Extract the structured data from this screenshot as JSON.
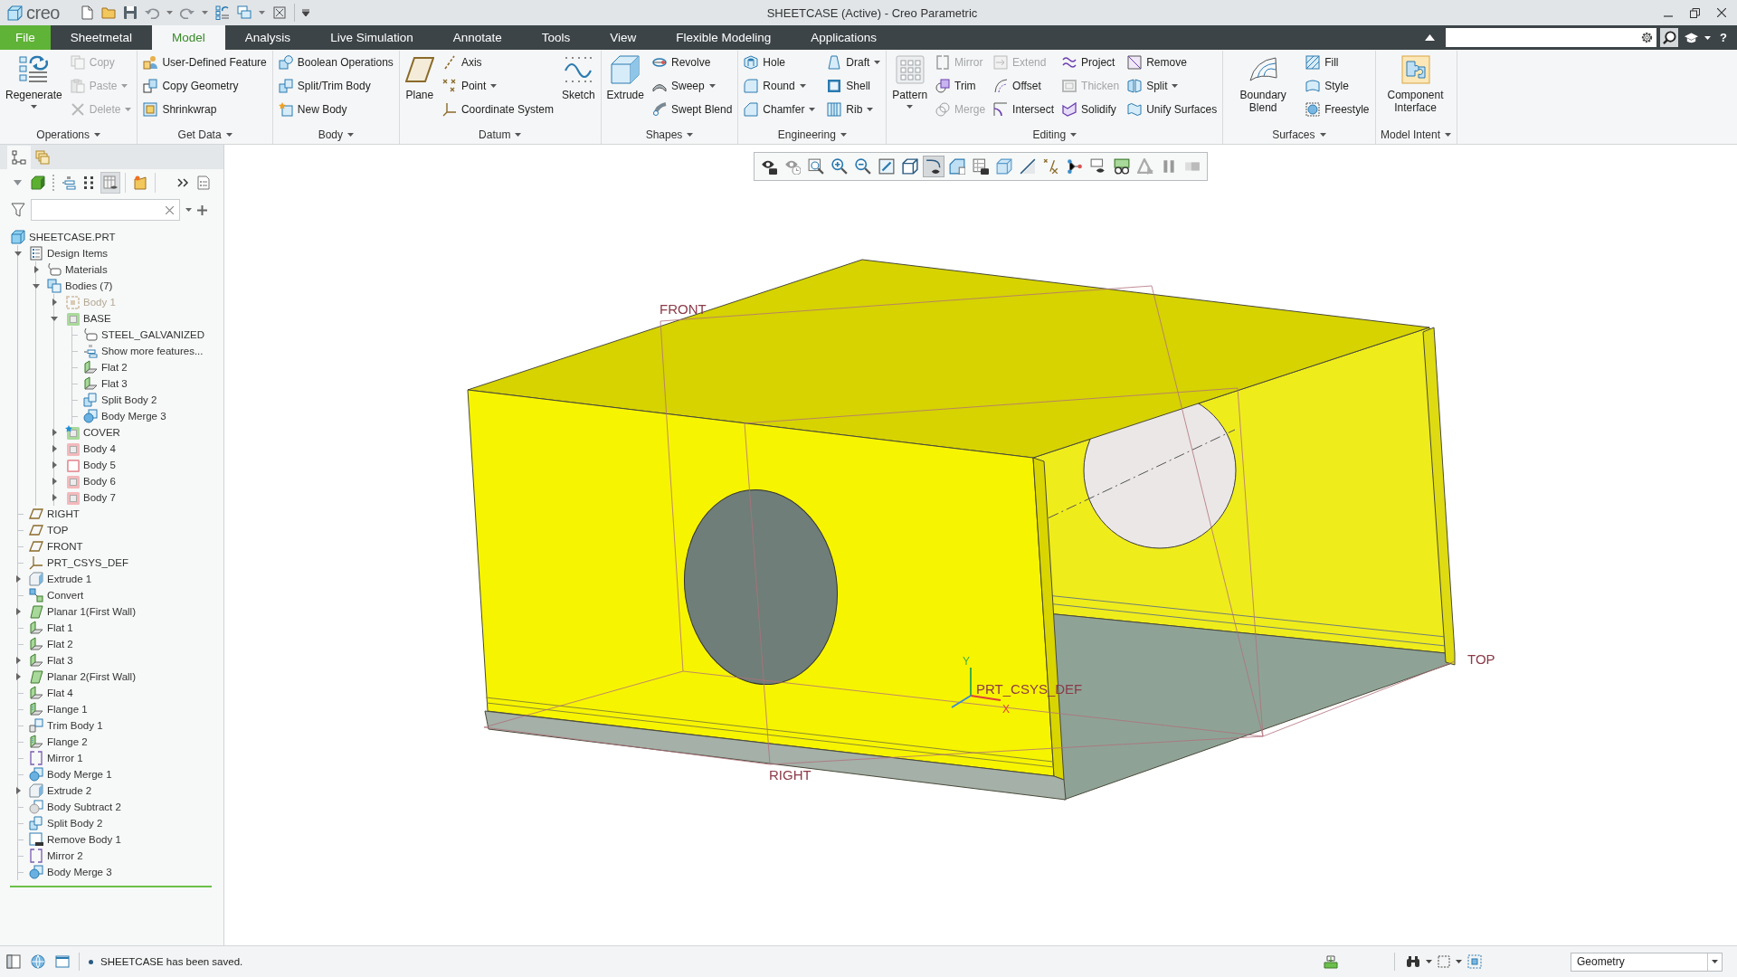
{
  "title_bar": {
    "logo": "creo",
    "title": "SHEETCASE (Active) - Creo Parametric"
  },
  "tabs": [
    {
      "label": "File",
      "kind": "menu",
      "selected": false
    },
    {
      "label": "Sheetmetal",
      "kind": "tab",
      "selected": false
    },
    {
      "label": "Model",
      "kind": "tab",
      "selected": true
    },
    {
      "label": "Analysis",
      "kind": "tab",
      "selected": false
    },
    {
      "label": "Live Simulation",
      "kind": "tab",
      "selected": false
    },
    {
      "label": "Annotate",
      "kind": "tab",
      "selected": false
    },
    {
      "label": "Tools",
      "kind": "tab",
      "selected": false
    },
    {
      "label": "View",
      "kind": "tab",
      "selected": false
    },
    {
      "label": "Flexible Modeling",
      "kind": "tab",
      "selected": false
    },
    {
      "label": "Applications",
      "kind": "tab",
      "selected": false
    }
  ],
  "help": "?",
  "ribbon": {
    "groups": [
      {
        "label": "Operations",
        "columns": [
          {
            "kind": "large",
            "items": [
              {
                "label": "Regenerate",
                "disabled": false,
                "dropdown": true
              }
            ]
          },
          {
            "kind": "stack",
            "items": [
              {
                "label": "Copy",
                "disabled": true,
                "dropdown": false
              },
              {
                "label": "Paste",
                "disabled": true,
                "dropdown": true
              },
              {
                "label": "Delete",
                "disabled": true,
                "dropdown": true
              }
            ]
          }
        ]
      },
      {
        "label": "Get Data",
        "columns": [
          {
            "kind": "stack",
            "items": [
              {
                "label": "User-Defined Feature",
                "disabled": false,
                "dropdown": false
              },
              {
                "label": "Copy Geometry",
                "disabled": false,
                "dropdown": false
              },
              {
                "label": "Shrinkwrap",
                "disabled": false,
                "dropdown": false
              }
            ]
          }
        ]
      },
      {
        "label": "Body",
        "columns": [
          {
            "kind": "stack",
            "items": [
              {
                "label": "Boolean Operations",
                "disabled": false,
                "dropdown": false
              },
              {
                "label": "Split/Trim Body",
                "disabled": false,
                "dropdown": false
              },
              {
                "label": "New Body",
                "disabled": false,
                "dropdown": false
              }
            ]
          }
        ]
      },
      {
        "label": "Datum",
        "columns": [
          {
            "kind": "large",
            "items": [
              {
                "label": "Plane",
                "disabled": false,
                "dropdown": false
              }
            ]
          },
          {
            "kind": "stack",
            "items": [
              {
                "label": "Axis",
                "disabled": false,
                "dropdown": false
              },
              {
                "label": "Point",
                "disabled": false,
                "dropdown": true
              },
              {
                "label": "Coordinate System",
                "disabled": false,
                "dropdown": false
              }
            ]
          },
          {
            "kind": "large",
            "items": [
              {
                "label": "Sketch",
                "disabled": false,
                "dropdown": false
              }
            ]
          }
        ]
      },
      {
        "label": "Shapes",
        "columns": [
          {
            "kind": "large",
            "items": [
              {
                "label": "Extrude",
                "disabled": false,
                "dropdown": false
              }
            ]
          },
          {
            "kind": "stack",
            "items": [
              {
                "label": "Revolve",
                "disabled": false,
                "dropdown": false
              },
              {
                "label": "Sweep",
                "disabled": false,
                "dropdown": true
              },
              {
                "label": "Swept Blend",
                "disabled": false,
                "dropdown": false
              }
            ]
          }
        ]
      },
      {
        "label": "Engineering",
        "columns": [
          {
            "kind": "stack",
            "items": [
              {
                "label": "Hole",
                "disabled": false,
                "dropdown": false
              },
              {
                "label": "Round",
                "disabled": false,
                "dropdown": true
              },
              {
                "label": "Chamfer",
                "disabled": false,
                "dropdown": true
              }
            ]
          },
          {
            "kind": "stack",
            "items": [
              {
                "label": "Draft",
                "disabled": false,
                "dropdown": true
              },
              {
                "label": "Shell",
                "disabled": false,
                "dropdown": false
              },
              {
                "label": "Rib",
                "disabled": false,
                "dropdown": true
              }
            ]
          }
        ]
      },
      {
        "label": "Editing",
        "columns": [
          {
            "kind": "large",
            "items": [
              {
                "label": "Pattern",
                "disabled": false,
                "dropdown": true
              }
            ]
          },
          {
            "kind": "stack",
            "items": [
              {
                "label": "Mirror",
                "disabled": true,
                "dropdown": false
              },
              {
                "label": "Trim",
                "disabled": false,
                "dropdown": false
              },
              {
                "label": "Merge",
                "disabled": true,
                "dropdown": false
              }
            ]
          },
          {
            "kind": "stack",
            "items": [
              {
                "label": "Extend",
                "disabled": true,
                "dropdown": false
              },
              {
                "label": "Offset",
                "disabled": false,
                "dropdown": false
              },
              {
                "label": "Intersect",
                "disabled": false,
                "dropdown": false
              }
            ]
          },
          {
            "kind": "stack",
            "items": [
              {
                "label": "Project",
                "disabled": false,
                "dropdown": false
              },
              {
                "label": "Thicken",
                "disabled": true,
                "dropdown": false
              },
              {
                "label": "Solidify",
                "disabled": false,
                "dropdown": false
              }
            ]
          },
          {
            "kind": "stack",
            "items": [
              {
                "label": "Remove",
                "disabled": false,
                "dropdown": false
              },
              {
                "label": "Split",
                "disabled": false,
                "dropdown": true
              },
              {
                "label": "Unify Surfaces",
                "disabled": false,
                "dropdown": false
              }
            ]
          }
        ]
      },
      {
        "label": "Surfaces",
        "columns": [
          {
            "kind": "large",
            "items": [
              {
                "label": "Boundary Blend",
                "disabled": false,
                "dropdown": false
              }
            ]
          },
          {
            "kind": "stack",
            "items": [
              {
                "label": "Fill",
                "disabled": false,
                "dropdown": false
              },
              {
                "label": "Style",
                "disabled": false,
                "dropdown": false
              },
              {
                "label": "Freestyle",
                "disabled": false,
                "dropdown": false
              }
            ]
          }
        ]
      },
      {
        "label": "Model Intent",
        "columns": [
          {
            "kind": "large",
            "items": [
              {
                "label": "Component Interface",
                "disabled": false,
                "dropdown": false
              }
            ]
          }
        ]
      }
    ]
  },
  "model_tree": {
    "tabs": [
      {
        "selected": true
      },
      {
        "selected": false
      }
    ],
    "toolbar": [
      {
        "selected": false
      },
      {
        "selected": false
      },
      {
        "selected": false
      },
      {
        "selected": false
      },
      {
        "selected": true
      },
      {
        "selected": false
      },
      {
        "selected": false
      },
      {
        "selected": false
      }
    ],
    "items": [
      {
        "label": "SHEETCASE.PRT",
        "kind": "part",
        "children": [
          {
            "label": "Design Items",
            "kind": "design_items",
            "expanded": true,
            "children": [
              {
                "label": "Materials",
                "kind": "materials",
                "expanded": false
              },
              {
                "label": "Bodies (7)",
                "kind": "bodies",
                "expanded": true,
                "children": [
                  {
                    "label": "Body 1",
                    "kind": "body",
                    "color": "#d8cbb6",
                    "hidden": true,
                    "default": false,
                    "empty": false,
                    "expanded": false
                  },
                  {
                    "label": "BASE",
                    "kind": "body",
                    "color": "#a9d99b",
                    "hidden": false,
                    "default": false,
                    "empty": false,
                    "expanded": true,
                    "children": [
                      {
                        "label": "STEEL_GALVANIZED",
                        "kind": "material"
                      },
                      {
                        "label": "Show more features...",
                        "kind": "more"
                      },
                      {
                        "label": "Flat 2",
                        "kind": "flat"
                      },
                      {
                        "label": "Flat 3",
                        "kind": "flat"
                      },
                      {
                        "label": "Split Body 2",
                        "kind": "split"
                      },
                      {
                        "label": "Body Merge 3",
                        "kind": "merge"
                      }
                    ]
                  },
                  {
                    "label": "COVER",
                    "kind": "body",
                    "color": "#a9d99b",
                    "hidden": false,
                    "default": true,
                    "empty": false,
                    "expanded": false
                  },
                  {
                    "label": "Body 4",
                    "kind": "body",
                    "color": "#f2b9bc",
                    "hidden": false,
                    "default": false,
                    "empty": false,
                    "expanded": false
                  },
                  {
                    "label": "Body 5",
                    "kind": "body",
                    "color": "#e8959b",
                    "hidden": false,
                    "default": false,
                    "empty": true,
                    "expanded": false
                  },
                  {
                    "label": "Body 6",
                    "kind": "body",
                    "color": "#f2b9bc",
                    "hidden": false,
                    "default": false,
                    "empty": false,
                    "expanded": false
                  },
                  {
                    "label": "Body 7",
                    "kind": "body",
                    "color": "#f2b9bc",
                    "hidden": false,
                    "default": false,
                    "empty": false,
                    "expanded": false
                  }
                ]
              }
            ]
          },
          {
            "label": "RIGHT",
            "kind": "plane"
          },
          {
            "label": "TOP",
            "kind": "plane"
          },
          {
            "label": "FRONT",
            "kind": "plane"
          },
          {
            "label": "PRT_CSYS_DEF",
            "kind": "csys"
          },
          {
            "label": "Extrude 1",
            "kind": "extrude",
            "expanded": false
          },
          {
            "label": "Convert",
            "kind": "convert"
          },
          {
            "label": "Planar 1(First Wall)",
            "kind": "planar",
            "expanded": false
          },
          {
            "label": "Flat 1",
            "kind": "flat"
          },
          {
            "label": "Flat 2",
            "kind": "flat"
          },
          {
            "label": "Flat 3",
            "kind": "flat",
            "expanded": false
          },
          {
            "label": "Planar 2(First Wall)",
            "kind": "planar",
            "expanded": false
          },
          {
            "label": "Flat 4",
            "kind": "flat"
          },
          {
            "label": "Flange 1",
            "kind": "flange"
          },
          {
            "label": "Trim Body 1",
            "kind": "trim"
          },
          {
            "label": "Flange 2",
            "kind": "flange"
          },
          {
            "label": "Mirror 1",
            "kind": "mirror"
          },
          {
            "label": "Body Merge 1",
            "kind": "merge"
          },
          {
            "label": "Extrude 2",
            "kind": "extrude",
            "expanded": false
          },
          {
            "label": "Body Subtract 2",
            "kind": "subtract"
          },
          {
            "label": "Split Body 2",
            "kind": "split"
          },
          {
            "label": "Remove Body 1",
            "kind": "remove"
          },
          {
            "label": "Mirror 2",
            "kind": "mirror"
          },
          {
            "label": "Body Merge 3",
            "kind": "merge"
          }
        ]
      }
    ]
  },
  "view_toolbar": {
    "buttons": [
      {
        "selected": false
      },
      {
        "selected": false
      },
      {
        "selected": false
      },
      {
        "selected": false
      },
      {
        "selected": false
      },
      {
        "selected": false
      },
      {
        "selected": false
      },
      {
        "selected": true
      },
      {
        "selected": false
      },
      {
        "selected": false
      },
      {
        "selected": false
      },
      {
        "selected": false
      },
      {
        "selected": false
      },
      {
        "selected": false
      },
      {
        "selected": false
      },
      {
        "selected": false
      },
      {
        "selected": false
      },
      {
        "selected": false
      },
      {
        "selected": false
      }
    ]
  },
  "canvas": {
    "datum_labels": [
      {
        "text": "FRONT"
      },
      {
        "text": "TOP"
      },
      {
        "text": "RIGHT"
      },
      {
        "text": "PRT_CSYS_DEF"
      }
    ],
    "axis_labels": [
      {
        "text": "Y",
        "color": "#3cb043"
      },
      {
        "text": "X",
        "color": "#e0403a"
      }
    ]
  },
  "status_bar": {
    "message": "SHEETCASE has been saved.",
    "filter": "Geometry"
  }
}
